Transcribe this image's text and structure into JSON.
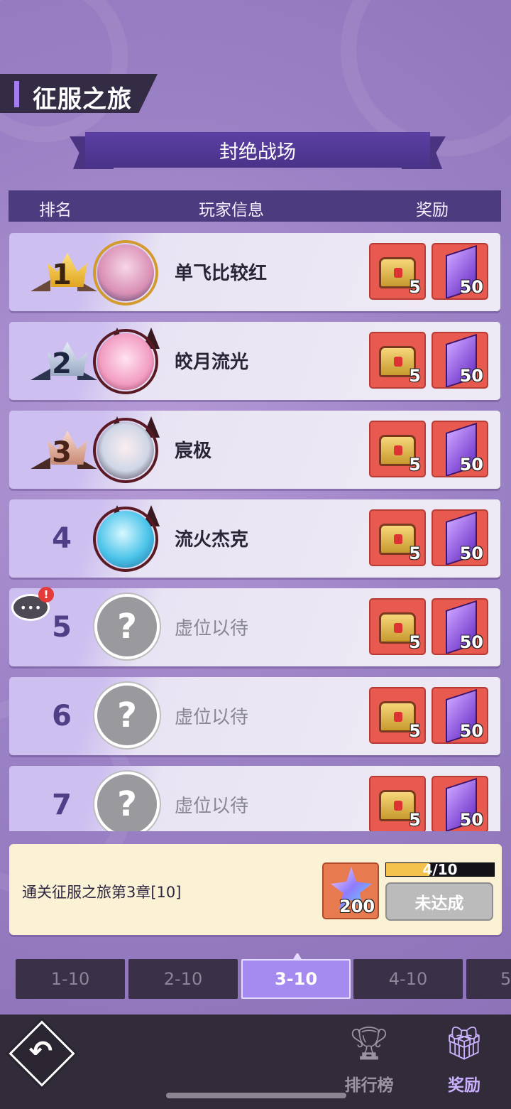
{
  "header": {
    "title": "征服之旅"
  },
  "banner": {
    "title": "封绝战场"
  },
  "columns": {
    "rank": "排名",
    "player": "玩家信息",
    "reward": "奖励"
  },
  "rows": [
    {
      "rank": "1",
      "name": "单飞比较红",
      "reward_chest": "5",
      "reward_crystal": "50"
    },
    {
      "rank": "2",
      "name": "皎月流光",
      "reward_chest": "5",
      "reward_crystal": "50"
    },
    {
      "rank": "3",
      "name": "宸极",
      "reward_chest": "5",
      "reward_crystal": "50"
    },
    {
      "rank": "4",
      "name": "流火杰克",
      "reward_chest": "5",
      "reward_crystal": "50"
    },
    {
      "rank": "5",
      "name": "虚位以待",
      "reward_chest": "5",
      "reward_crystal": "50"
    },
    {
      "rank": "6",
      "name": "虚位以待",
      "reward_chest": "5",
      "reward_crystal": "50"
    },
    {
      "rank": "7",
      "name": "虚位以待",
      "reward_chest": "5",
      "reward_crystal": "50"
    }
  ],
  "placeholder_avatar": "?",
  "task": {
    "description": "通关征服之旅第3章[10]",
    "reward_count": "200",
    "progress_label": "4/10",
    "progress_fraction": 0.4,
    "status": "未达成"
  },
  "chapter_tabs": [
    "1-10",
    "2-10",
    "3-10",
    "4-10",
    "5"
  ],
  "active_tab": "3-10",
  "nav": {
    "ranking": "排行榜",
    "reward": "奖励"
  },
  "colors": {
    "accent": "#a58af0",
    "reward_bg": "#e85a4f",
    "progress": "#f2c24a"
  }
}
